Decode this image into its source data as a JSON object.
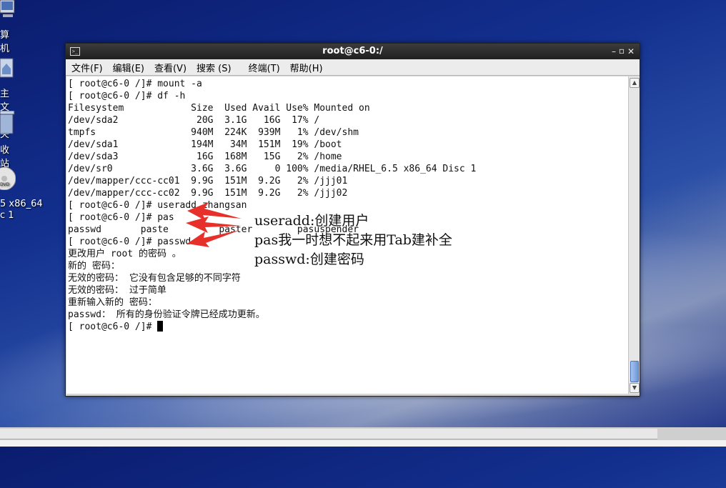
{
  "desktop": {
    "icons": [
      {
        "label": "算机"
      },
      {
        "label": "主文件夹"
      },
      {
        "label": "收站"
      },
      {
        "label": "5 x86_64\nc 1"
      }
    ]
  },
  "window": {
    "title": "root@c6-0:/",
    "menu": [
      "文件(F)",
      "编辑(E)",
      "查看(V)",
      "搜索 (S)",
      "终端(T)",
      "帮助(H)"
    ]
  },
  "terminal": {
    "lines": [
      "[ root@c6-0 /]# mount -a",
      "[ root@c6-0 /]# df -h",
      "Filesystem            Size  Used Avail Use% Mounted on",
      "/dev/sda2              20G  3.1G   16G  17% /",
      "tmpfs                 940M  224K  939M   1% /dev/shm",
      "/dev/sda1             194M   34M  151M  19% /boot",
      "/dev/sda3              16G  168M   15G   2% /home",
      "/dev/sr0              3.6G  3.6G     0 100% /media/RHEL_6.5 x86_64 Disc 1",
      "/dev/mapper/ccc-cc01  9.9G  151M  9.2G   2% /jjj01",
      "/dev/mapper/ccc-cc02  9.9G  151M  9.2G   2% /jjj02",
      "[ root@c6-0 /]# useradd zhangsan",
      "[ root@c6-0 /]# pas",
      "passwd       paste         paster        pasuspender",
      "[ root@c6-0 /]# passwd",
      "更改用户 root 的密码 。",
      "新的 密码：",
      "无效的密码： 它没有包含足够的不同字符",
      "无效的密码： 过于简单",
      "重新输入新的 密码：",
      "passwd： 所有的身份验证令牌已经成功更新。"
    ],
    "prompt": "[ root@c6-0 /]# "
  },
  "annotations": [
    "useradd:创建用户",
    "pas我一时想不起来用Tab建补全",
    "passwd:创建密码"
  ],
  "colors": {
    "arrow": "#e8302a"
  }
}
